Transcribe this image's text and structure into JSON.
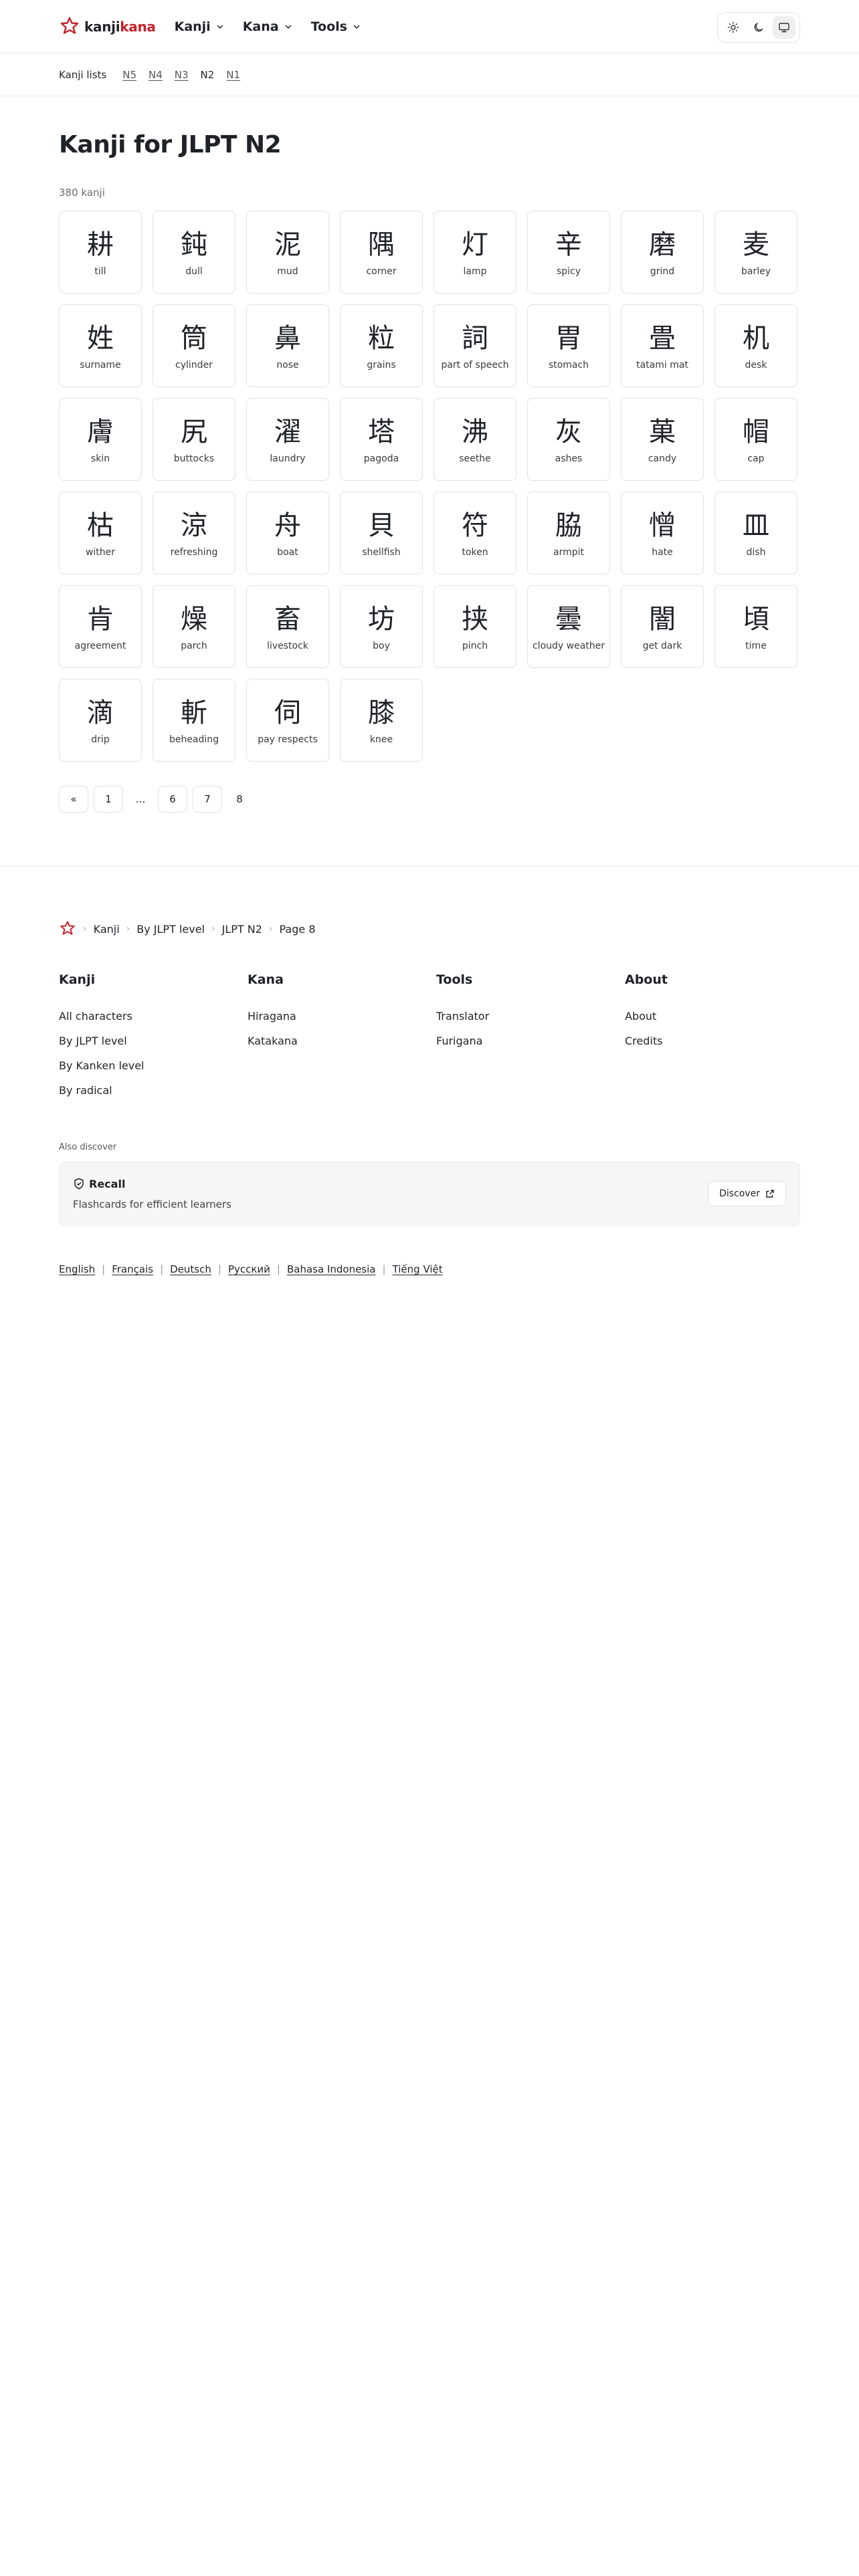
{
  "header": {
    "logo": {
      "kanji": "kanji",
      "kana": "kana"
    },
    "nav": [
      {
        "label": "Kanji"
      },
      {
        "label": "Kana"
      },
      {
        "label": "Tools"
      }
    ],
    "theme_modes": [
      "sun-icon",
      "moon-icon",
      "monitor-icon"
    ],
    "accent_color": "#c8202a"
  },
  "subnav": {
    "label": "Kanji lists",
    "levels": [
      "N5",
      "N4",
      "N3",
      "N2",
      "N1"
    ],
    "current": "N2"
  },
  "main": {
    "title": "Kanji for JLPT N2",
    "count": "380 kanji",
    "cards": [
      {
        "kanji": "耕",
        "meaning": "till"
      },
      {
        "kanji": "鈍",
        "meaning": "dull"
      },
      {
        "kanji": "泥",
        "meaning": "mud"
      },
      {
        "kanji": "隅",
        "meaning": "corner"
      },
      {
        "kanji": "灯",
        "meaning": "lamp"
      },
      {
        "kanji": "辛",
        "meaning": "spicy"
      },
      {
        "kanji": "磨",
        "meaning": "grind"
      },
      {
        "kanji": "麦",
        "meaning": "barley"
      },
      {
        "kanji": "姓",
        "meaning": "surname"
      },
      {
        "kanji": "筒",
        "meaning": "cylinder"
      },
      {
        "kanji": "鼻",
        "meaning": "nose"
      },
      {
        "kanji": "粒",
        "meaning": "grains"
      },
      {
        "kanji": "詞",
        "meaning": "part of speech"
      },
      {
        "kanji": "胃",
        "meaning": "stomach"
      },
      {
        "kanji": "畳",
        "meaning": "tatami mat"
      },
      {
        "kanji": "机",
        "meaning": "desk"
      },
      {
        "kanji": "膚",
        "meaning": "skin"
      },
      {
        "kanji": "尻",
        "meaning": "buttocks"
      },
      {
        "kanji": "濯",
        "meaning": "laundry"
      },
      {
        "kanji": "塔",
        "meaning": "pagoda"
      },
      {
        "kanji": "沸",
        "meaning": "seethe"
      },
      {
        "kanji": "灰",
        "meaning": "ashes"
      },
      {
        "kanji": "菓",
        "meaning": "candy"
      },
      {
        "kanji": "帽",
        "meaning": "cap"
      },
      {
        "kanji": "枯",
        "meaning": "wither"
      },
      {
        "kanji": "涼",
        "meaning": "refreshing"
      },
      {
        "kanji": "舟",
        "meaning": "boat"
      },
      {
        "kanji": "貝",
        "meaning": "shellfish"
      },
      {
        "kanji": "符",
        "meaning": "token"
      },
      {
        "kanji": "脇",
        "meaning": "armpit"
      },
      {
        "kanji": "憎",
        "meaning": "hate"
      },
      {
        "kanji": "皿",
        "meaning": "dish"
      },
      {
        "kanji": "肯",
        "meaning": "agreement"
      },
      {
        "kanji": "燥",
        "meaning": "parch"
      },
      {
        "kanji": "畜",
        "meaning": "livestock"
      },
      {
        "kanji": "坊",
        "meaning": "boy"
      },
      {
        "kanji": "挟",
        "meaning": "pinch"
      },
      {
        "kanji": "曇",
        "meaning": "cloudy weather"
      },
      {
        "kanji": "闇",
        "meaning": "get dark"
      },
      {
        "kanji": "頃",
        "meaning": "time"
      },
      {
        "kanji": "滴",
        "meaning": "drip"
      },
      {
        "kanji": "斬",
        "meaning": "beheading"
      },
      {
        "kanji": "伺",
        "meaning": "pay respects"
      },
      {
        "kanji": "膝",
        "meaning": "knee"
      }
    ],
    "pagination": {
      "prev": "«",
      "first": "1",
      "ellipsis": "…",
      "p6": "6",
      "p7": "7",
      "current": "8"
    }
  },
  "footer": {
    "breadcrumb": [
      "Kanji",
      "By JLPT level",
      "JLPT N2",
      "Page 8"
    ],
    "columns": [
      {
        "title": "Kanji",
        "links": [
          "All characters",
          "By JLPT level",
          "By Kanken level",
          "By radical"
        ]
      },
      {
        "title": "Kana",
        "links": [
          "Hiragana",
          "Katakana"
        ]
      },
      {
        "title": "Tools",
        "links": [
          "Translator",
          "Furigana"
        ]
      },
      {
        "title": "About",
        "links": [
          "About",
          "Credits"
        ]
      }
    ],
    "also_discover": "Also discover",
    "promo": {
      "title": "Recall",
      "description": "Flashcards for efficient learners",
      "button": "Discover"
    },
    "languages": [
      "English",
      "Français",
      "Deutsch",
      "Русский",
      "Bahasa Indonesia",
      "Tiếng Việt"
    ]
  }
}
